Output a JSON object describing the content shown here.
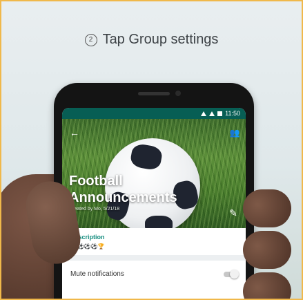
{
  "instruction": {
    "step": "2",
    "text": "Tap Group settings"
  },
  "status_bar": {
    "time": "11:50"
  },
  "group": {
    "title": "Football Announcements",
    "created": "Created by Mo, 5/21/18"
  },
  "description": {
    "label": "Description",
    "value": "🏆⚽⚽⚽🏆"
  },
  "settings": {
    "mute_label": "Mute notifications",
    "mute_on": false
  },
  "colors": {
    "header": "#075e54",
    "accent": "#128c7e",
    "frame": "#f0b84a"
  },
  "icons": {
    "back": "back-arrow-icon",
    "add": "add-participant-icon",
    "edit": "pencil-icon"
  }
}
